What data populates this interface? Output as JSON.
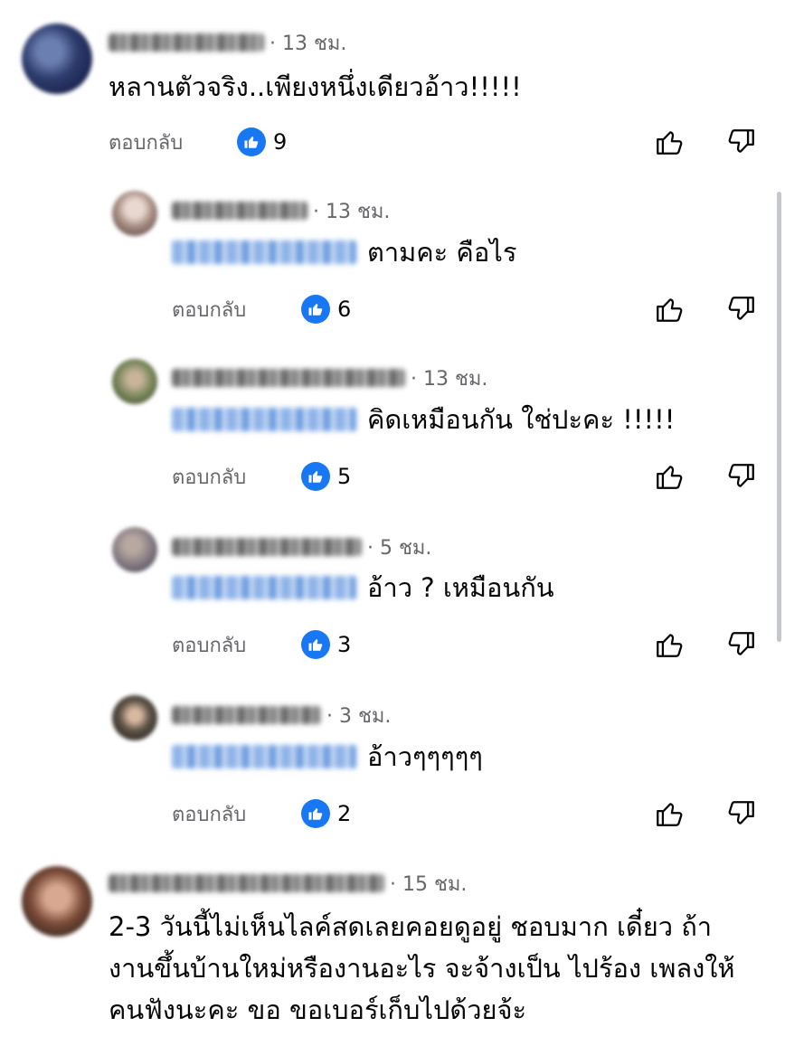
{
  "ui": {
    "reply_label": "ตอบกลับ"
  },
  "comments": [
    {
      "time": "· 13 ชม.",
      "text": "หลานตัวจริง..เพียงหนึ่งเดียวอ้าว!!!!!",
      "likes": "9"
    },
    {
      "time": "· 13 ชม.",
      "text": "ตามคะ คือไร",
      "likes": "6"
    },
    {
      "time": "· 13 ชม.",
      "text": "คิดเหมือนกัน ใช่ปะคะ !!!!!",
      "likes": "5"
    },
    {
      "time": "· 5 ชม.",
      "text": "อ้าว ? เหมือนกัน",
      "likes": "3"
    },
    {
      "time": "· 3 ชม.",
      "text": "อ้าวๆๆๆๆๆ",
      "likes": "2"
    },
    {
      "time": "· 15 ชม.",
      "text": "2-3 วันนี้ไม่เห็นไลค์สดเลยคอยดูอยู่ ชอบมาก เดี๋ยว ถ้างานขึ้นบ้านใหม่หรืองานอะไร จะจ้างเป็น ไปร้อง เพลงให้คนฟังนะคะ ขอ ขอเบอร์เก็บไปด้วยจ้ะ"
    }
  ],
  "colors": {
    "like_blue": "#1877f2",
    "meta_gray": "#65676b",
    "mention_blue": "#8fb3e8"
  },
  "icons": [
    "like-badge-icon",
    "thumbs-up-icon",
    "thumbs-down-icon"
  ]
}
